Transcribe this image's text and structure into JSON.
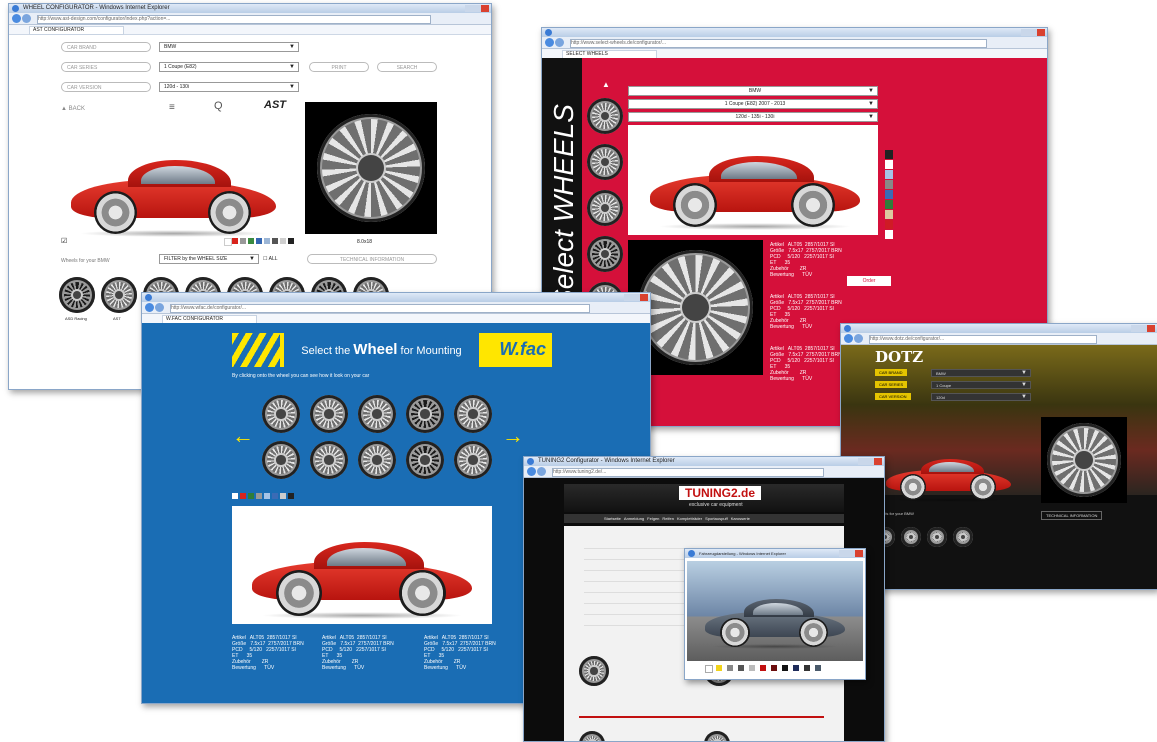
{
  "w1": {
    "title": "WHEEL CONFIGURATOR - Windows Internet Explorer",
    "url": "http://www.ast-design.com/configurator/index.php?action=...",
    "tab": "AST CONFIGURATOR",
    "f_brand": "CAR BRAND",
    "f_series": "CAR SERIES",
    "f_version": "CAR VERSION",
    "s_brand": "BMW",
    "s_series": "1 Coupe (E82)",
    "s_version": "120d - 130i",
    "btn_print": "PRINT",
    "btn_search": "SEARCH",
    "back": "BACK",
    "size": "8.0x18",
    "wheels_for": "Wheels for your BMW",
    "filter": "FILTER by the WHEEL SIZE",
    "all": "ALL",
    "tech": "TECHNICAL INFORMATION",
    "w1_label": "ASD Racing",
    "w2_label": "AST"
  },
  "w2": {
    "url": "http://www.select-wheels.de/configurator/...",
    "tab": "SELECT WHEELS",
    "vertical": "Select WHEELS",
    "sel1": "BMW",
    "sel2": "1 Coupe (E82) 2007 - 2013",
    "sel3": "120d - 135i - 130i",
    "specs": "Artikel   ALT05  2857/1017 SI\nGröße   7.5x17  2757/2017 BRN\nPCD     5/120   2257/1017 SI\nET      35\nZubehör        ZR\nBewertung      TÜV",
    "order": "Order"
  },
  "w3": {
    "url": "http://www.wfac.de/configurator/...",
    "tab": "W.FAC CONFIGURATOR",
    "headline_a": "Select the",
    "headline_b": "Wheel",
    "headline_c": "for Mounting",
    "logo": "W.fac",
    "info": "By clicking onto the wheel you can see how it look on your car",
    "specs": "Artikel   ALT05  2857/1017 SI\nGröße   7.5x17  2757/2017 BRN\nPCD     5/120   2257/1017 SI\nET      35\nZubehör        ZR\nBewertung      TÜV"
  },
  "w4": {
    "url": "http://www.dotz.de/configurator/...",
    "logo": "DOTZ",
    "m1": "CAR BRAND",
    "m2": "CAR SERIES",
    "m3": "CAR VERSION",
    "v1": "BMW",
    "v2": "1 Coupe",
    "v3": "120d",
    "wheels_for": "Wheels for your BMW",
    "tech": "TECHNICAL INFORMATION"
  },
  "w5": {
    "title": "TUNING2 Configurator - Windows Internet Explorer",
    "url": "http://www.tuning2.de/...",
    "logo": "TUNING2.de",
    "tagline": "exclusive car equipment",
    "menu": [
      "Startseite",
      "Anmeldung",
      "Felgen",
      "Reifen",
      "Kompletträder",
      "Sportauspuff",
      "Karosserie"
    ],
    "popup_title": "Fahrzeugdarstellung - Windows Internet Explorer"
  }
}
